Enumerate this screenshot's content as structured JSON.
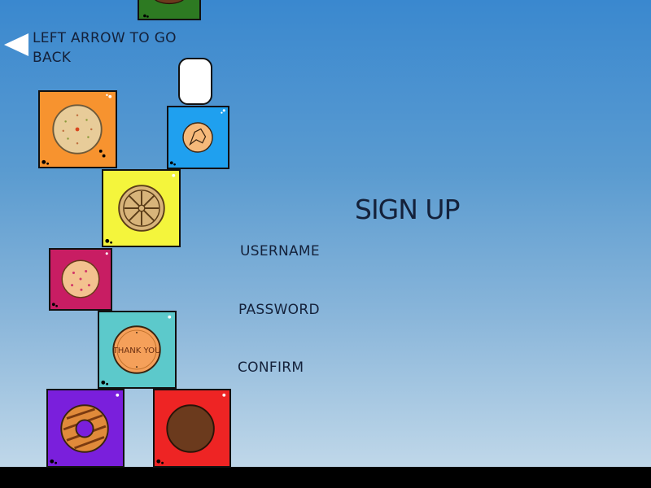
{
  "nav": {
    "back_hint": "LEFT ARROW TO GO BACK"
  },
  "form": {
    "title": "SIGN UP",
    "username_label": "USERNAME",
    "password_label": "PASSWORD",
    "confirm_label": "CONFIRM"
  },
  "cookie_texts": {
    "thank_you": "THANK YOU"
  },
  "colors": {
    "sky_top": "#3a88cf",
    "sky_bottom": "#c7dceb",
    "ground": "#000000",
    "text": "#14213a",
    "box_green": "#2d7a22",
    "box_orange": "#f7932f",
    "box_blue": "#1fa0ef",
    "box_yellow": "#f4f53c",
    "box_magenta": "#c81d63",
    "box_teal": "#5cc9cb",
    "box_purple": "#7a1fdc",
    "box_red": "#ee2424"
  },
  "icons": [
    "back-arrow-icon",
    "cookie-icon",
    "pill-block-icon"
  ]
}
